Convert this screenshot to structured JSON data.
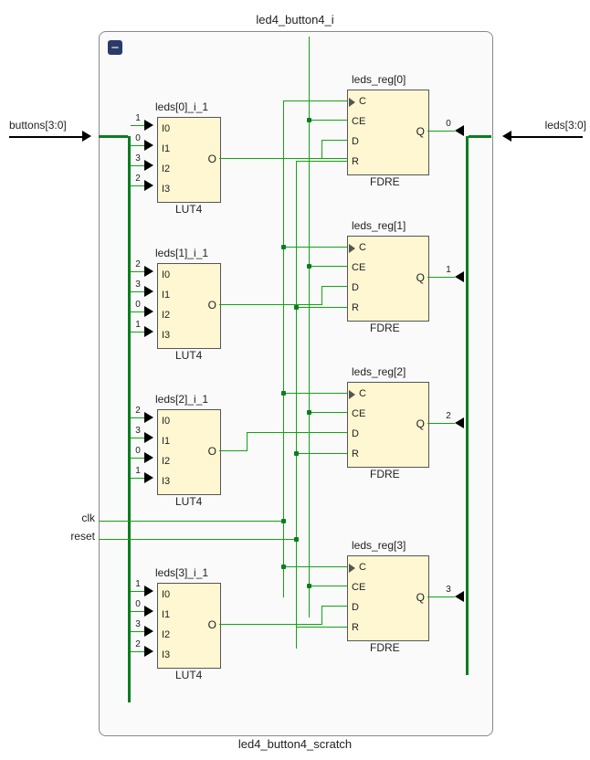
{
  "module": {
    "title_top": "led4_button4_i",
    "title_bottom": "led4_button4_scratch"
  },
  "ports": {
    "buttons": "buttons[3:0]",
    "leds": "leds[3:0]",
    "clk": "clk",
    "reset": "reset"
  },
  "luts": [
    {
      "title": "leds[0]_i_1",
      "type": "LUT4",
      "inputs": [
        "I0",
        "I1",
        "I2",
        "I3"
      ],
      "output": "O",
      "bit_order": [
        "1",
        "0",
        "3",
        "2"
      ]
    },
    {
      "title": "leds[1]_i_1",
      "type": "LUT4",
      "inputs": [
        "I0",
        "I1",
        "I2",
        "I3"
      ],
      "output": "O",
      "bit_order": [
        "2",
        "3",
        "0",
        "1"
      ]
    },
    {
      "title": "leds[2]_i_1",
      "type": "LUT4",
      "inputs": [
        "I0",
        "I1",
        "I2",
        "I3"
      ],
      "output": "O",
      "bit_order": [
        "2",
        "3",
        "0",
        "1"
      ]
    },
    {
      "title": "leds[3]_i_1",
      "type": "LUT4",
      "inputs": [
        "I0",
        "I1",
        "I2",
        "I3"
      ],
      "output": "O",
      "bit_order": [
        "1",
        "0",
        "3",
        "2"
      ]
    }
  ],
  "regs": [
    {
      "title": "leds_reg[0]",
      "type": "FDRE",
      "inputs": [
        "C",
        "CE",
        "D",
        "R"
      ],
      "output": "Q",
      "out_bit": "0"
    },
    {
      "title": "leds_reg[1]",
      "type": "FDRE",
      "inputs": [
        "C",
        "CE",
        "D",
        "R"
      ],
      "output": "Q",
      "out_bit": "1"
    },
    {
      "title": "leds_reg[2]",
      "type": "FDRE",
      "inputs": [
        "C",
        "CE",
        "D",
        "R"
      ],
      "output": "Q",
      "out_bit": "2"
    },
    {
      "title": "leds_reg[3]",
      "type": "FDRE",
      "inputs": [
        "C",
        "CE",
        "D",
        "R"
      ],
      "output": "Q",
      "out_bit": "3"
    }
  ]
}
